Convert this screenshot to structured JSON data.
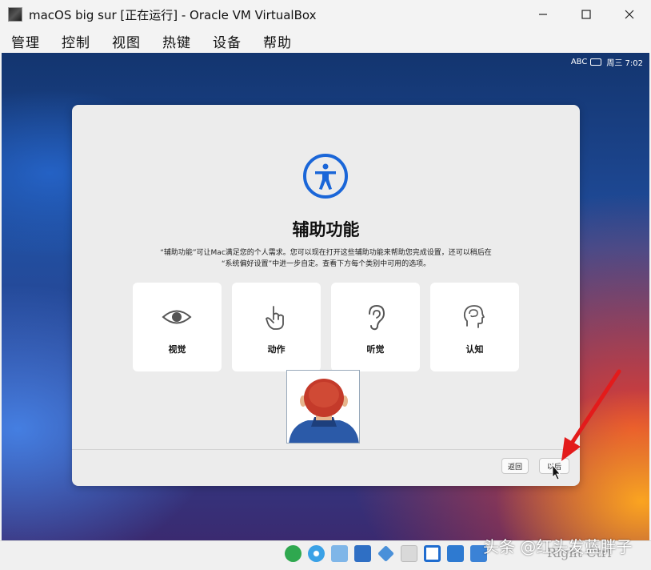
{
  "window": {
    "title": "macOS big sur [正在运行] - Oracle VM VirtualBox",
    "controls": {
      "minimize": "—",
      "maximize": "☐",
      "close": "✕"
    }
  },
  "menu": {
    "items": [
      {
        "label": "管理"
      },
      {
        "label": "控制"
      },
      {
        "label": "视图"
      },
      {
        "label": "热键"
      },
      {
        "label": "设备"
      },
      {
        "label": "帮助"
      }
    ]
  },
  "vm": {
    "status": {
      "input_method": "ABC",
      "datetime": "周三 7:02"
    },
    "setup": {
      "title": "辅助功能",
      "description_line1": "“辅助功能”可让Mac满足您的个人需求。您可以现在打开这些辅助功能来帮助您完成设置，还可以稍后在",
      "description_line2": "“系统偏好设置”中进一步自定。查看下方每个类别中可用的选项。",
      "categories": [
        {
          "label": "视觉",
          "icon": "eye-icon"
        },
        {
          "label": "动作",
          "icon": "hand-pointer-icon"
        },
        {
          "label": "听觉",
          "icon": "ear-icon"
        },
        {
          "label": "认知",
          "icon": "head-brain-icon"
        }
      ],
      "back_label": "返回",
      "later_label": "以后"
    }
  },
  "statusbar": {
    "host_key": "Right Ctrl"
  },
  "watermark": "头条 @红头发蓝胖子",
  "colors": {
    "accent_blue": "#1a66d8",
    "annotation_red": "#e31b1b"
  }
}
